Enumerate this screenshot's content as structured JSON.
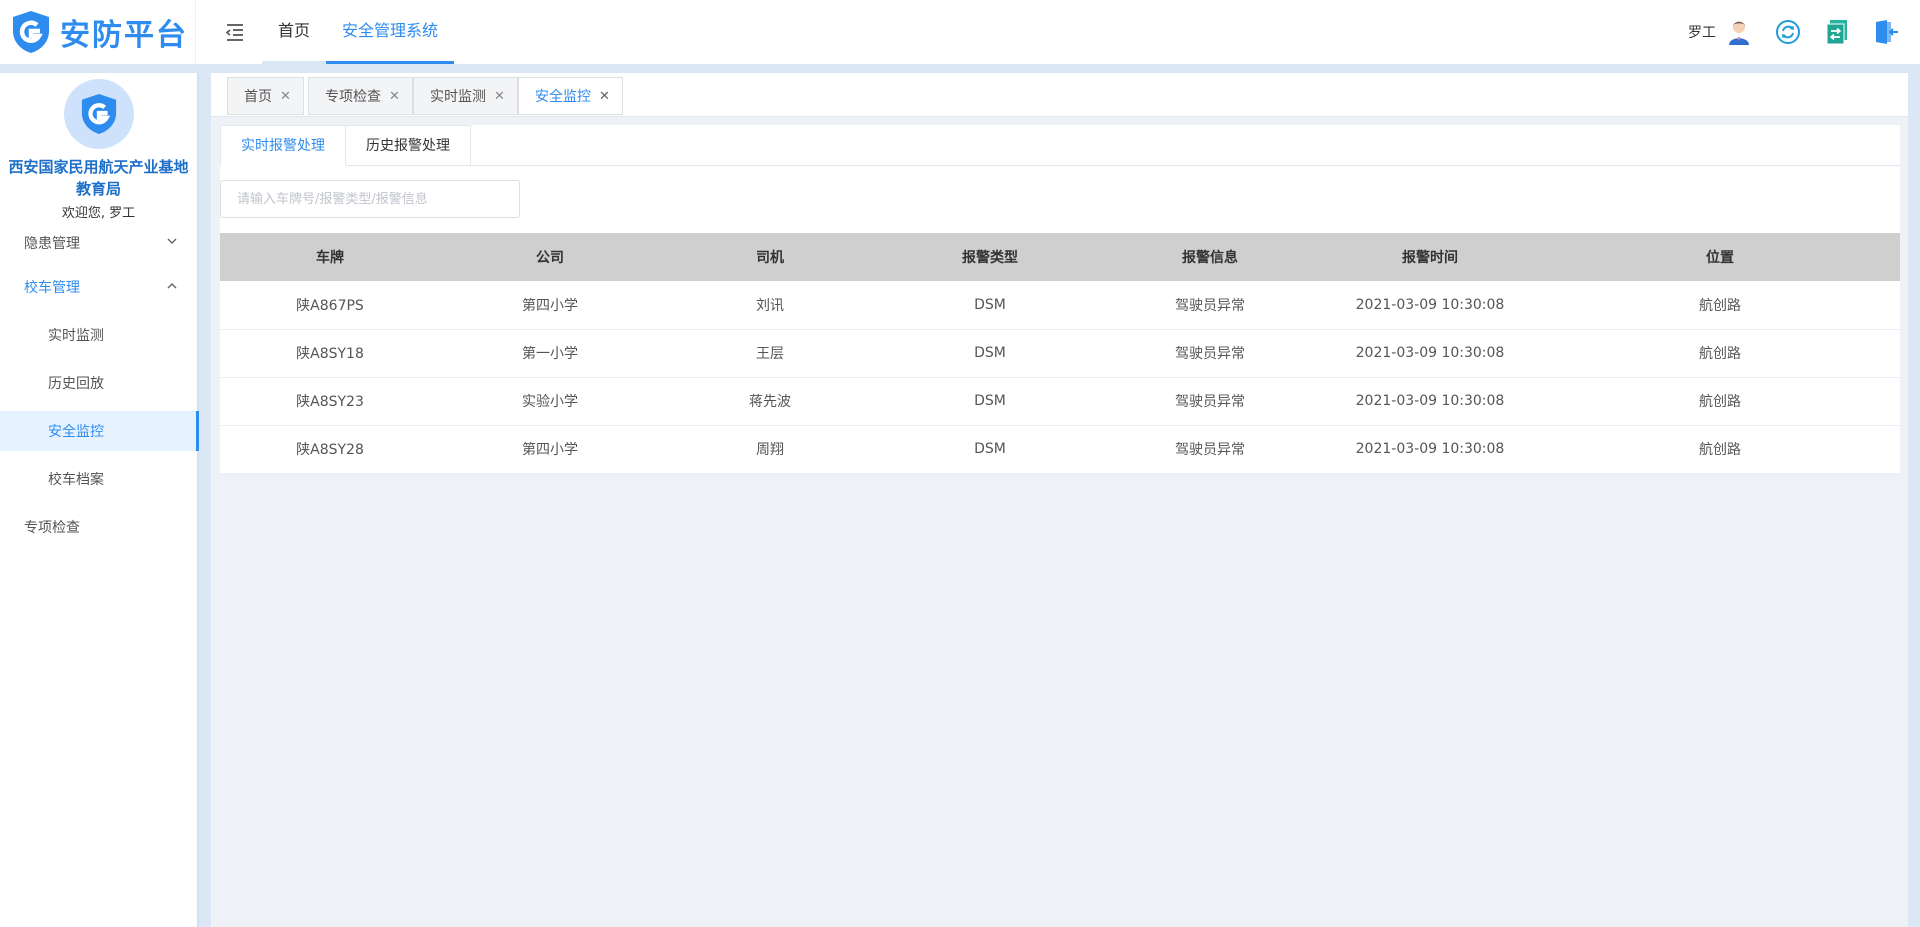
{
  "app": {
    "name": "安防平台"
  },
  "topnav": {
    "items": [
      "首页",
      "安全管理系统"
    ]
  },
  "user": {
    "name": "罗工"
  },
  "sidebar": {
    "org_name_line1": "西安国家民用航天产业基地",
    "org_name_line2": "教育局",
    "welcome": "欢迎您, 罗工",
    "menu": {
      "hazard": "隐患管理",
      "bus_mgmt": "校车管理",
      "realtime": "实时监测",
      "history": "历史回放",
      "security": "安全监控",
      "archive": "校车档案",
      "special": "专项检查"
    }
  },
  "tags": [
    "首页",
    "专项检查",
    "实时监测",
    "安全监控"
  ],
  "subtabs": [
    "实时报警处理",
    "历史报警处理"
  ],
  "search": {
    "placeholder": "请输入车牌号/报警类型/报警信息"
  },
  "table": {
    "columns": [
      "车牌",
      "公司",
      "司机",
      "报警类型",
      "报警信息",
      "报警时间",
      "位置"
    ],
    "rows": [
      [
        "陕A867PS",
        "第四小学",
        "刘讯",
        "DSM",
        "驾驶员异常",
        "2021-03-09 10:30:08",
        "航创路"
      ],
      [
        "陕A8SY18",
        "第一小学",
        "王层",
        "DSM",
        "驾驶员异常",
        "2021-03-09 10:30:08",
        "航创路"
      ],
      [
        "陕A8SY23",
        "实验小学",
        "蒋先波",
        "DSM",
        "驾驶员异常",
        "2021-03-09 10:30:08",
        "航创路"
      ],
      [
        "陕A8SY28",
        "第四小学",
        "周翔",
        "DSM",
        "驾驶员异常",
        "2021-03-09 10:30:08",
        "航创路"
      ]
    ]
  },
  "icons": {
    "logo": "shield-g-icon",
    "menu_toggle": "menu-fold-icon",
    "avatar": "user-avatar-icon",
    "refresh": "refresh-icon",
    "switch": "switch-icon",
    "logout": "logout-icon",
    "close": "close-icon",
    "chevron_down": "chevron-down-icon",
    "chevron_up": "chevron-up-icon"
  },
  "colors": {
    "accent": "#2f8cef",
    "org_text": "#1e6fc8",
    "table_header": "#cfcfcf",
    "background": "#dbe7f5"
  }
}
